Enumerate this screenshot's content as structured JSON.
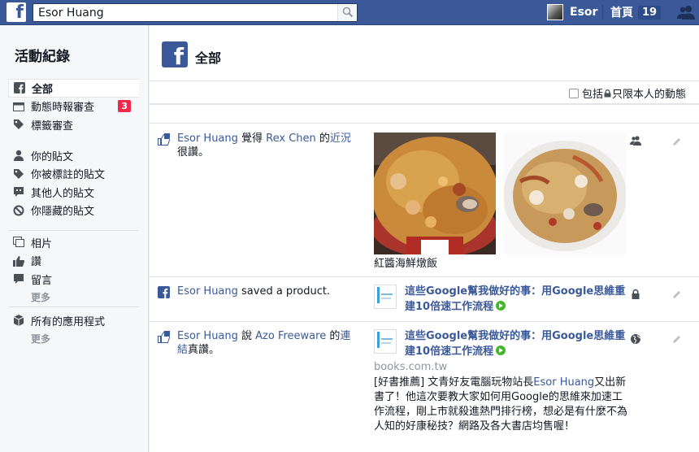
{
  "topbar": {
    "logo": "f",
    "search_value": "Esor Huang",
    "user_name": "Esor",
    "home_label": "首頁",
    "home_count": "19"
  },
  "leftnav": {
    "title": "活動紀錄",
    "items": [
      {
        "label": "全部",
        "icon": "facebook-icon"
      },
      {
        "label": "動態時報審查",
        "icon": "timeline-icon",
        "badge": "3"
      },
      {
        "label": "標籤審查",
        "icon": "tag-icon"
      },
      {
        "label": "你的貼文",
        "icon": "person-icon"
      },
      {
        "label": "你被標註的貼文",
        "icon": "tag-icon"
      },
      {
        "label": "其他人的貼文",
        "icon": "speech-icon"
      },
      {
        "label": "你隱藏的貼文",
        "icon": "block-icon"
      },
      {
        "label": "相片",
        "icon": "photos-icon"
      },
      {
        "label": "讚",
        "icon": "like-icon"
      },
      {
        "label": "留言",
        "icon": "comment-icon"
      },
      {
        "label": "更多"
      },
      {
        "label": "所有的應用程式",
        "icon": "cube-icon"
      },
      {
        "label": "更多"
      }
    ]
  },
  "main": {
    "title": "全部",
    "filter_label": "包括",
    "filter_label_after": "只限本人的動態",
    "rows": [
      {
        "actor": "Esor Huang",
        "text1": " 覺得 ",
        "target": "Rex Chen",
        "text2": " 的",
        "object": "近況",
        "text3": "很讚。",
        "caption": "紅醬海鮮燉飯",
        "privacy": "friends-icon"
      },
      {
        "actor": "Esor Huang",
        "text1": " saved a product.",
        "link_title": "這些Google幫我做好的事：用Google思維重建10倍速工作流程",
        "privacy": "lock-icon"
      },
      {
        "actor": "Esor Huang",
        "text1": " 說 ",
        "target": "Azo Freeware",
        "text2": " 的",
        "object": "連結",
        "text3": "真讚。",
        "link_title": "這些Google幫我做好的事：用Google思維重建10倍速工作流程",
        "domain": "books.com.tw",
        "desc_a": "[好書推薦] 文青好友電腦玩物站長",
        "desc_link": "Esor Huang",
        "desc_b": "又出新書了！他這次要教大家如何用Google的思維來加速工作流程，剛上市就殺進熱門排行榜，想必是有什麼不為人知的好康秘技？網路及各大書店均售喔！",
        "privacy": "globe-icon"
      }
    ]
  },
  "colors": {
    "brand": "#3b5998",
    "badge": "#f02849",
    "go": "#42b72a"
  }
}
